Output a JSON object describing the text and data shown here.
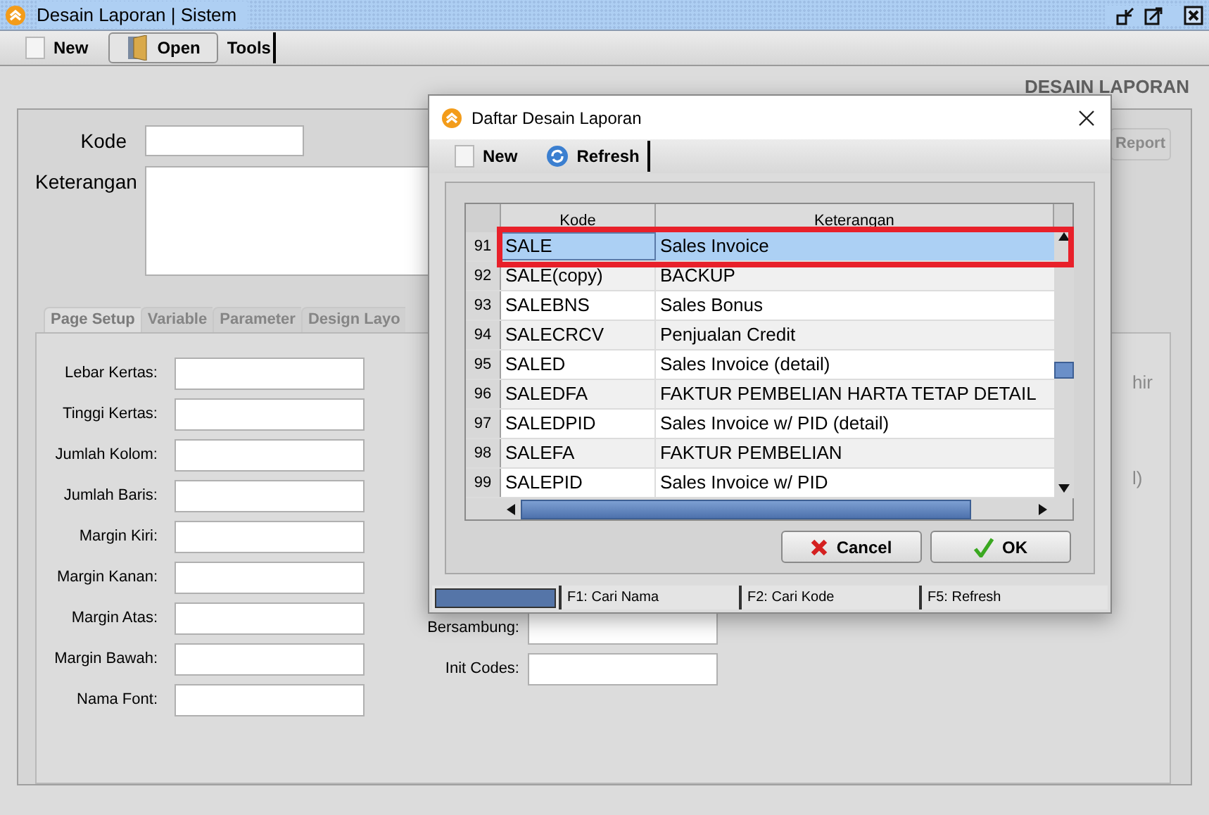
{
  "window": {
    "title": "Desain Laporan | Sistem"
  },
  "toolbar": [
    {
      "label": "New",
      "kind": "check"
    },
    {
      "label": "Open",
      "kind": "door"
    },
    {
      "label": "Tools",
      "kind": "menu"
    }
  ],
  "heading": "DESAIN LAPORAN",
  "form": {
    "kode_label": "Kode",
    "keterangan_label": "Keterangan",
    "report_button": {
      "label": "Report",
      "disabled": true
    }
  },
  "tabs": [
    {
      "label": "Page Setup",
      "selected": true
    },
    {
      "label": "Variable",
      "selected": false
    },
    {
      "label": "Parameter",
      "selected": false
    },
    {
      "label": "Design Layo",
      "selected": false
    }
  ],
  "page_setup_fields": [
    "Lebar Kertas:",
    "Tinggi Kertas:",
    "Jumlah Kolom:",
    "Jumlah Baris:",
    "Margin Kiri:",
    "Margin Kanan:",
    "Margin Atas:",
    "Margin Bawah:",
    "Nama Font:"
  ],
  "right_fields": [
    "Bersambung:",
    "Init Codes:"
  ],
  "partial_texts": [
    "hir",
    "l)"
  ],
  "dialog": {
    "title": "Daftar Desain Laporan",
    "toolbar": [
      {
        "label": "New",
        "kind": "check"
      },
      {
        "label": "Refresh",
        "kind": "refresh"
      }
    ],
    "table": {
      "columns": [
        "Kode",
        "Keterangan"
      ],
      "rows": [
        {
          "num": "91",
          "kode": "SALE",
          "keterangan": "Sales Invoice",
          "selected": true
        },
        {
          "num": "92",
          "kode": "SALE(copy)",
          "keterangan": "BACKUP",
          "selected": false
        },
        {
          "num": "93",
          "kode": "SALEBNS",
          "keterangan": "Sales Bonus",
          "selected": false
        },
        {
          "num": "94",
          "kode": "SALECRCV",
          "keterangan": "Penjualan Credit",
          "selected": false
        },
        {
          "num": "95",
          "kode": "SALED",
          "keterangan": "Sales Invoice (detail)",
          "selected": false
        },
        {
          "num": "96",
          "kode": "SALEDFA",
          "keterangan": "FAKTUR PEMBELIAN HARTA TETAP DETAIL",
          "selected": false
        },
        {
          "num": "97",
          "kode": "SALEDPID",
          "keterangan": "Sales Invoice w/ PID (detail)",
          "selected": false
        },
        {
          "num": "98",
          "kode": "SALEFA",
          "keterangan": "FAKTUR PEMBELIAN",
          "selected": false
        },
        {
          "num": "99",
          "kode": "SALEPID",
          "keterangan": "Sales Invoice w/ PID",
          "selected": false
        }
      ]
    },
    "buttons": [
      {
        "label": "Cancel",
        "kind": "cancel"
      },
      {
        "label": "OK",
        "kind": "ok"
      }
    ],
    "status_bar": [
      "F1: Cari Nama",
      "F2: Cari Kode",
      "F5: Refresh"
    ]
  }
}
